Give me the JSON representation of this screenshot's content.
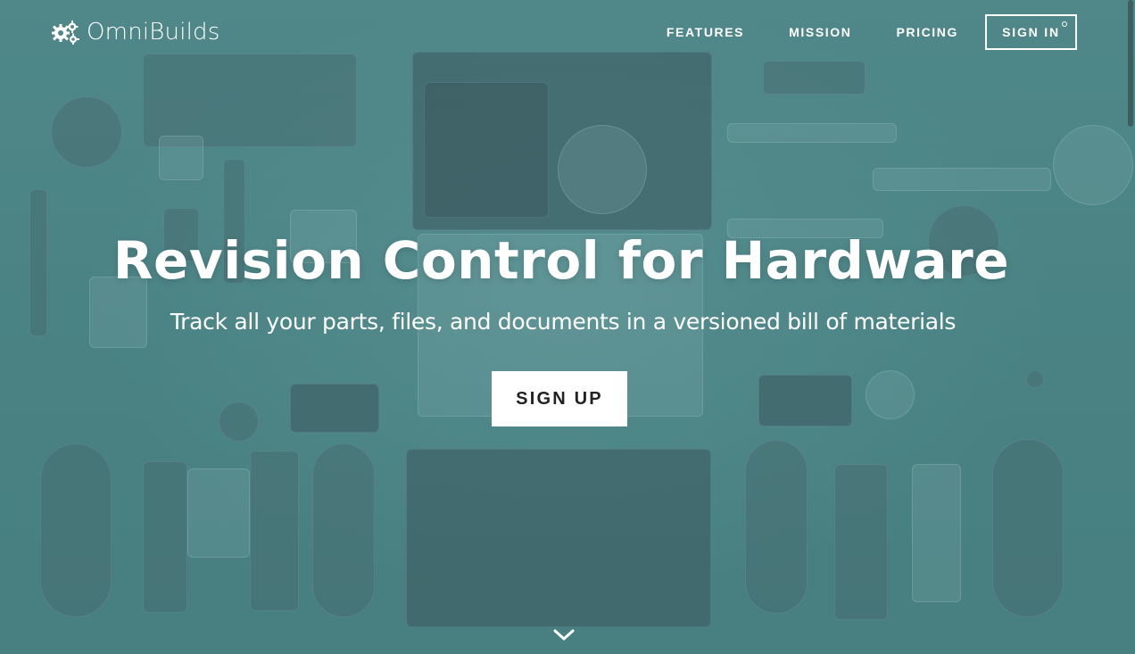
{
  "brand": {
    "logo_icon": "gears-icon",
    "name": "OmniBuilds"
  },
  "nav": {
    "items": [
      {
        "label": "FEATURES"
      },
      {
        "label": "MISSION"
      },
      {
        "label": "PRICING"
      }
    ],
    "signin_label": "SIGN IN"
  },
  "hero": {
    "headline": "Revision Control for Hardware",
    "subheadline": "Track all your parts, files, and documents in a versioned bill of materials",
    "cta_label": "SIGN UP",
    "scroll_icon": "chevron-down-icon",
    "background_image": "disassembled handheld game console parts on teal background"
  },
  "colors": {
    "overlay": "#4f8586",
    "button_bg": "#ffffff",
    "button_text": "#222222",
    "text": "#ffffff"
  }
}
